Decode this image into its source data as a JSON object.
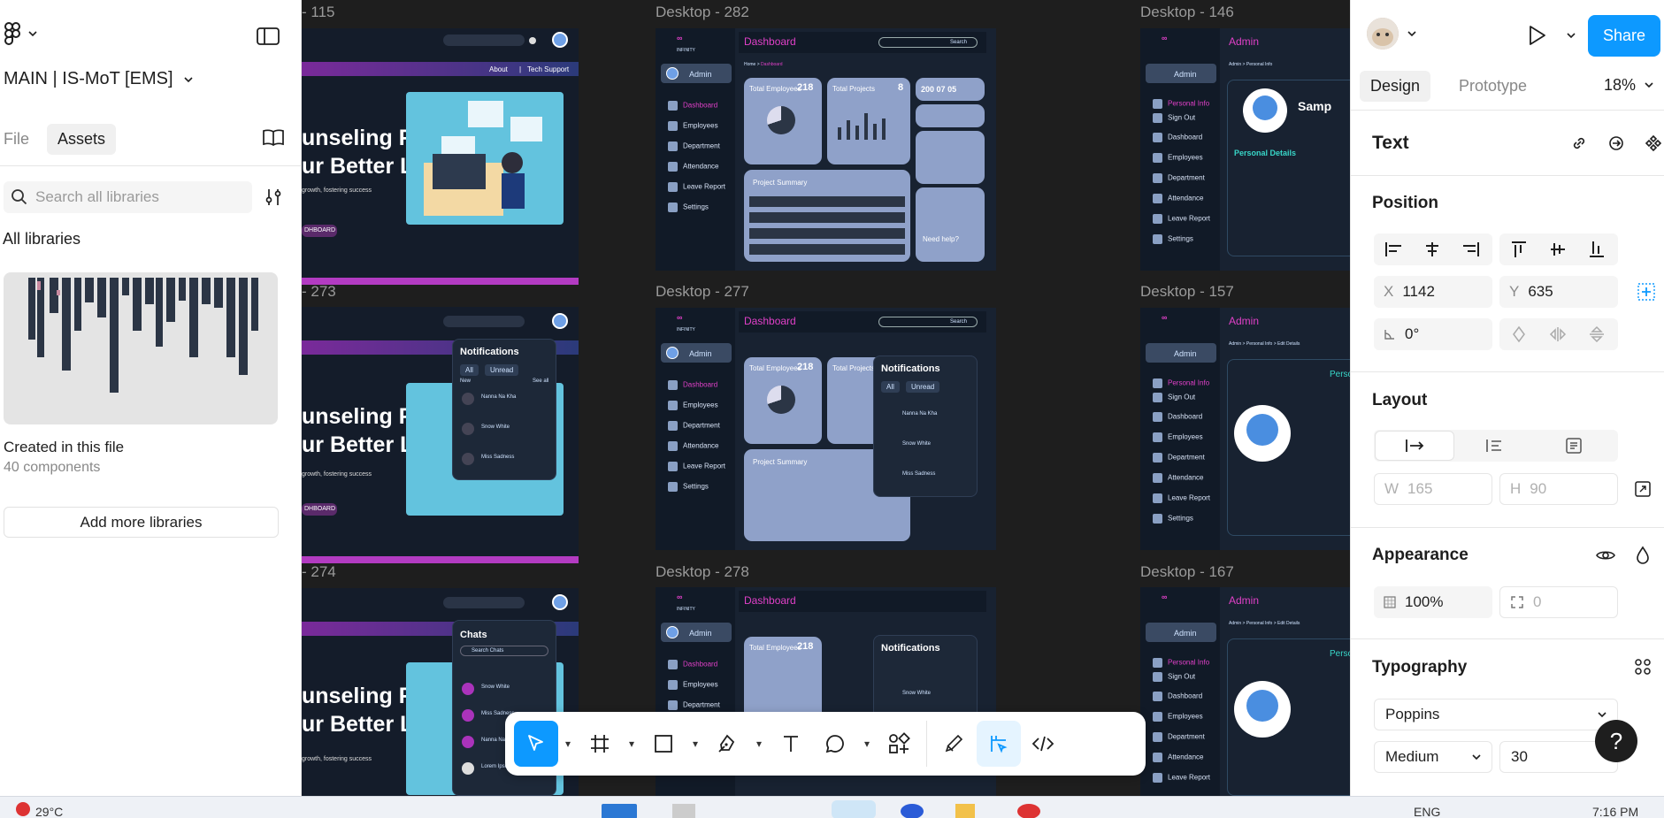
{
  "left_panel": {
    "project_title": "MAIN | IS-MoT [EMS]",
    "tabs": [
      {
        "label": "File"
      },
      {
        "label": "Assets"
      }
    ],
    "search_placeholder": "Search all libraries",
    "section_title": "All libraries",
    "library": {
      "name": "Created in this file",
      "count": "40 components"
    },
    "add_button": "Add more libraries"
  },
  "canvas": {
    "frames": [
      {
        "label": "- 115"
      },
      {
        "label": "Desktop - 282"
      },
      {
        "label": "Desktop - 146"
      },
      {
        "label": "- 273"
      },
      {
        "label": "Desktop - 277"
      },
      {
        "label": "Desktop - 157"
      },
      {
        "label": "- 274"
      },
      {
        "label": "Desktop - 278"
      },
      {
        "label": "Desktop - 167"
      }
    ],
    "landing": {
      "headline_1": "unseling For",
      "headline_2": "ur Better Life",
      "tagline": "growth, fostering success",
      "cta": "DHBOARD",
      "nav_about": "About",
      "nav_sep": "|",
      "nav_support": "Tech Support",
      "notifications_title": "Notifications",
      "notif_tab_all": "All",
      "notif_tab_unread": "Unread",
      "notif_new": "New",
      "notif_see_all": "See all",
      "notif_items": [
        "Nanna Na Kha",
        "Snow White",
        "Miss Sadness"
      ],
      "chats_title": "Chats",
      "chats_search": "Search Chats",
      "chat_items": [
        "Snow White",
        "Miss Sadness",
        "Nanna Na Kha",
        "Lorem Ipsum"
      ]
    },
    "dashboard": {
      "logo": "INFINITY",
      "title": "Dashboard",
      "search": "Search",
      "admin": "Admin",
      "breadcrumb_home": "Home >",
      "breadcrumb_page": "Dashboard",
      "nav": [
        "Dashboard",
        "Employees",
        "Department",
        "Attendance",
        "Leave Report",
        "Settings"
      ],
      "total_employees_label": "Total Employees",
      "total_employees_value": "218",
      "total_projects_label": "Total Projects",
      "total_projects_value": "8",
      "counters": [
        "200",
        "07",
        "05"
      ],
      "project_summary": "Project Summary",
      "need_help": "Need help?"
    },
    "admin": {
      "title": "Admin",
      "breadcrumb_1": "Admin > Personal Info",
      "breadcrumb_2": "Admin > Personal Info > Edit Details",
      "nav": [
        "Personal Info",
        "Sign Out",
        "Dashboard",
        "Employees",
        "Department",
        "Attendance",
        "Leave Report",
        "Settings"
      ],
      "name_partial": "Samp",
      "personal_details": "Personal Details",
      "perso_partial": "Perso"
    }
  },
  "toolbar": {
    "tools": [
      "move-tool",
      "frame-tool",
      "shape-tool",
      "pen-tool",
      "text-tool",
      "comment-tool",
      "actions-tool",
      "draw-mode",
      "design-mode",
      "dev-mode"
    ],
    "active": "move-tool"
  },
  "right_panel": {
    "share_label": "Share",
    "tabs": [
      {
        "label": "Design"
      },
      {
        "label": "Prototype"
      }
    ],
    "zoom": "18%",
    "selection_type": "Text",
    "position": {
      "title": "Position",
      "x_label": "X",
      "x_value": "1142",
      "y_label": "Y",
      "y_value": "635",
      "rotation_value": "0°"
    },
    "layout": {
      "title": "Layout",
      "w_label": "W",
      "w_value": "165",
      "h_label": "H",
      "h_value": "90"
    },
    "appearance": {
      "title": "Appearance",
      "opacity": "100%",
      "radius": "0"
    },
    "typography": {
      "title": "Typography",
      "font_family": "Poppins",
      "font_weight": "Medium",
      "font_size": "30"
    },
    "help_label": "?"
  },
  "taskbar": {
    "weather": "29°C",
    "lang": "ENG",
    "time": "7:16 PM"
  },
  "colors": {
    "accent": "#0d99ff",
    "canvas": "#1e1e1e",
    "dashboard_bg": "#182231",
    "brand_pink": "#e040c8"
  }
}
